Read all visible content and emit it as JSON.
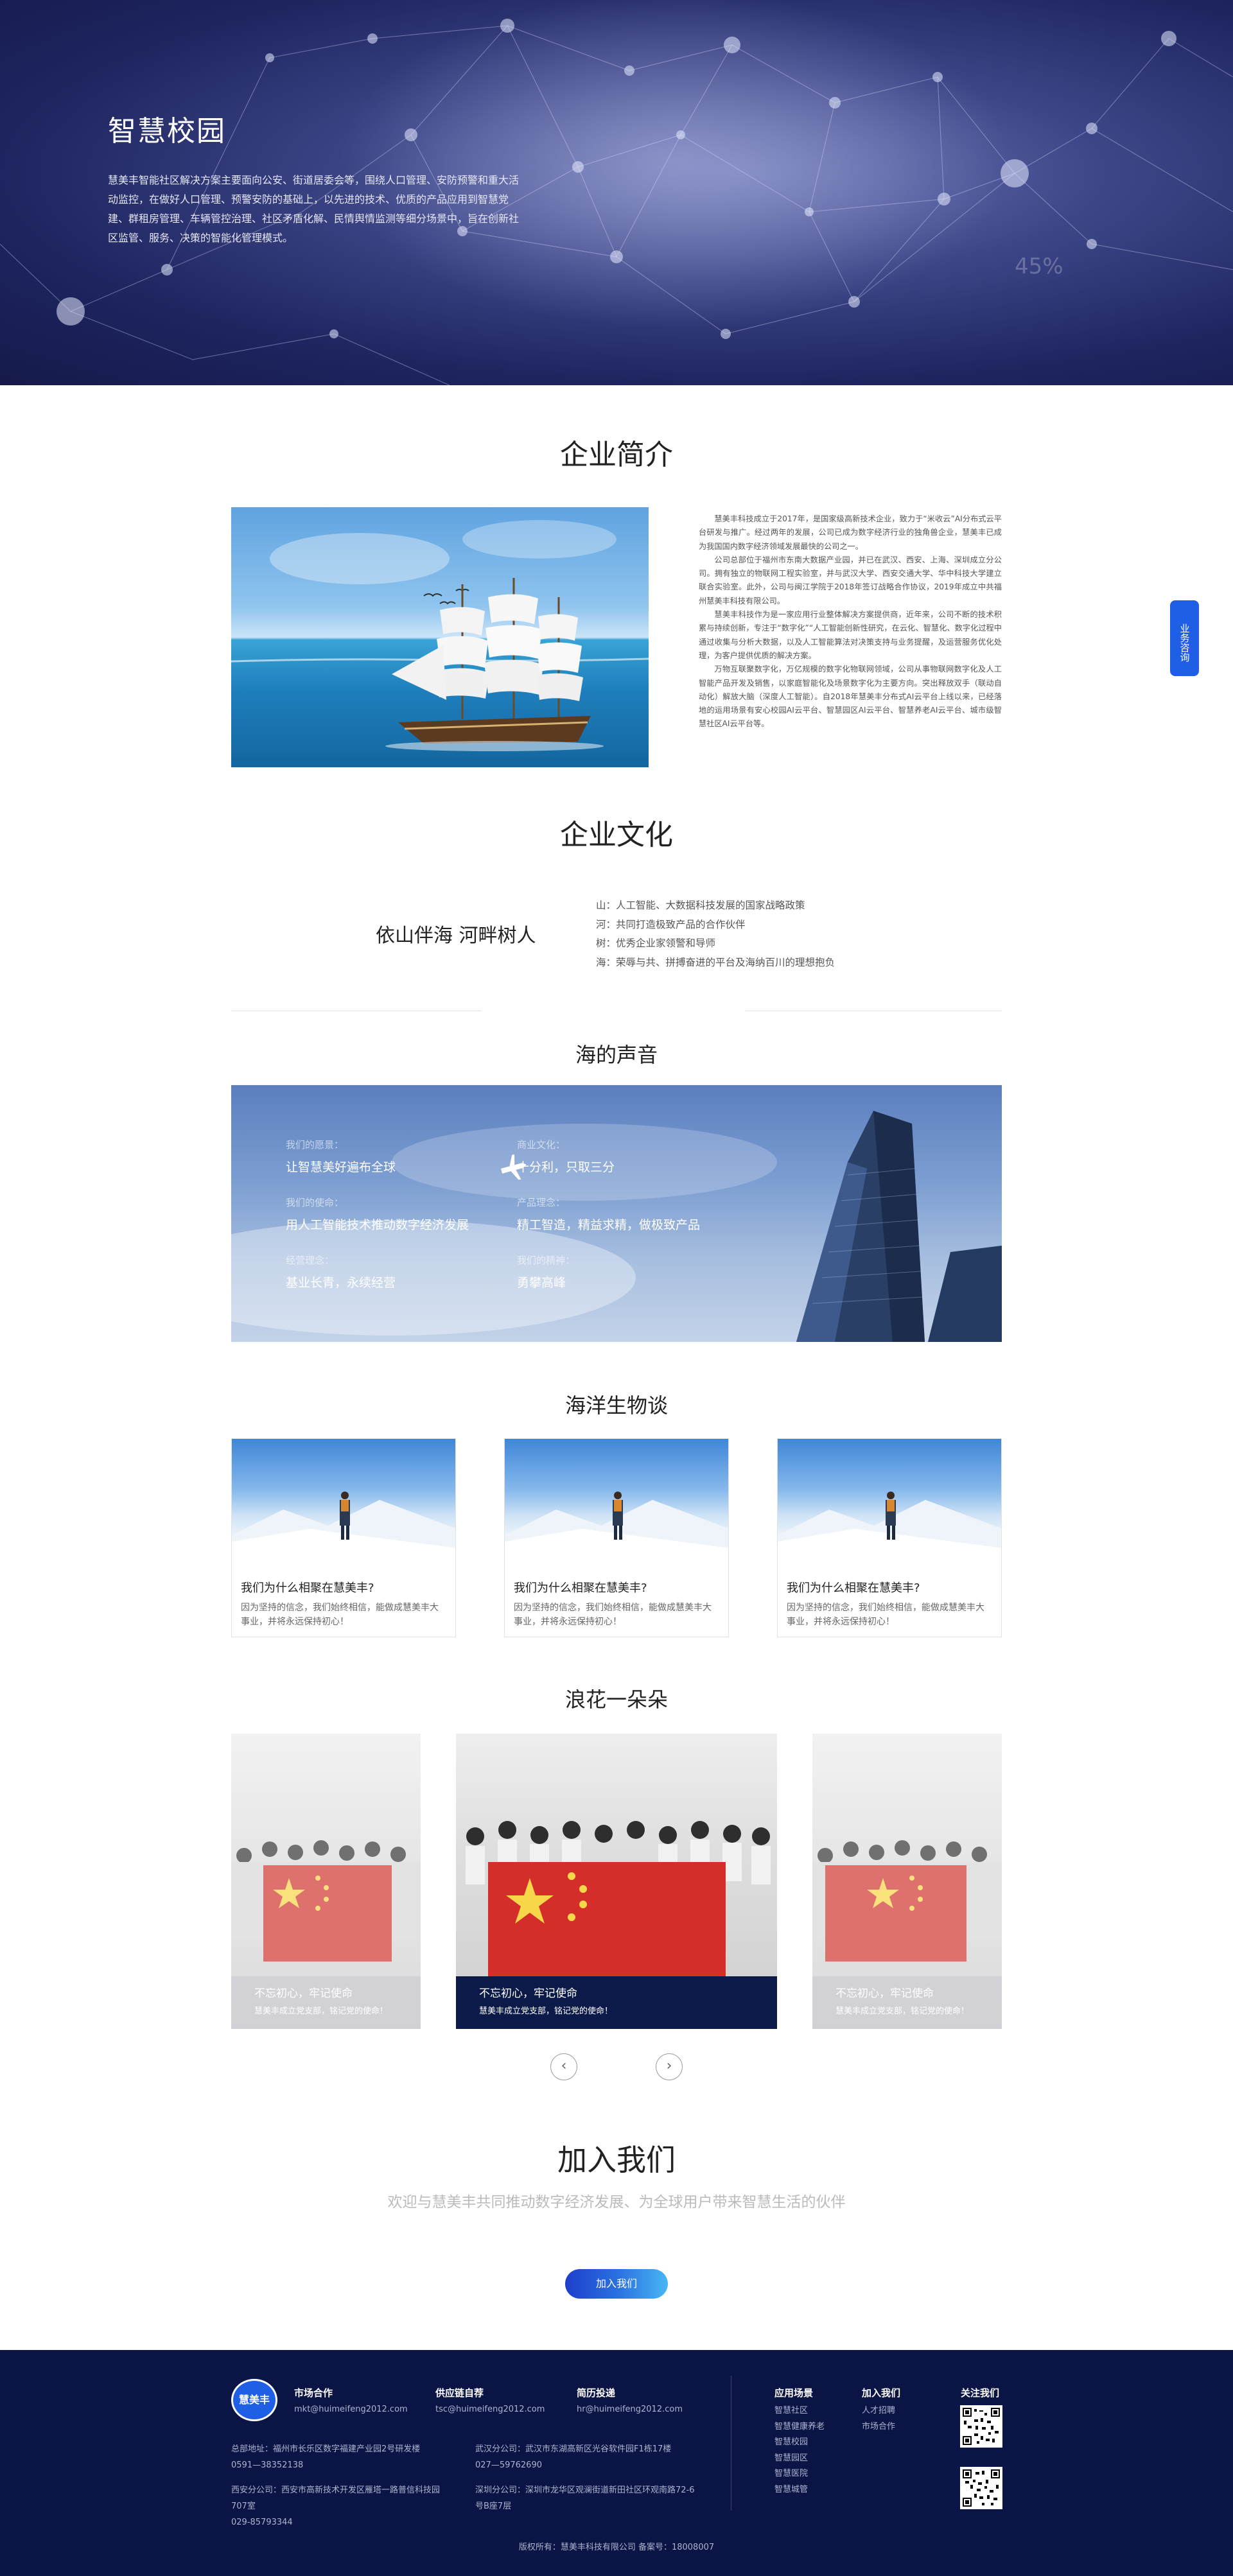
{
  "hero": {
    "title": "智慧校园",
    "desc": "慧美丰智能社区解决方案主要面向公安、街道居委会等，围绕人口管理、安防预警和重大活动监控，在做好人口管理、预警安防的基础上，以先进的技术、优质的产品应用到智慧党建、群租房管理、车辆管控治理、社区矛盾化解、民情舆情监测等细分场景中，旨在创新社区监管、服务、决策的智能化管理模式。",
    "deco_number": "45%"
  },
  "side_consult": "业务咨询",
  "intro": {
    "title": "企业简介",
    "paragraphs": [
      "慧美丰科技成立于2017年，是国家级高新技术企业，致力于“米收云”AI分布式云平台研发与推广。经过两年的发展，公司已成为数字经济行业的独角兽企业，慧美丰已成为我国国内数字经济领域发展最快的公司之一。",
      "公司总部位于福州市东南大数据产业园，并已在武汉、西安、上海、深圳成立分公司。拥有独立的物联网工程实验室，并与武汉大学、西安交通大学、华中科技大学建立联合实验室。此外，公司与闽江学院于2018年签订战略合作协议，2019年成立中共福州慧美丰科技有限公司。",
      "慧美丰科技作为是一家应用行业整体解决方案提供商，近年来，公司不断的技术积累与持续创新，专注于“数字化”“人工智能创新性研究，在云化、智慧化、数字化过程中通过收集与分析大数据，以及人工智能算法对决策支持与业务提醒，及运营服务优化处理，为客户提供优质的解决方案。",
      "万物互联聚数字化，万亿规模的数字化物联网领域，公司从事物联网数字化及人工智能产品开发及销售，以家庭智能化及场景数字化为主要方向。突出释放双手（联动自动化）解放大脑（深度人工智能）。自2018年慧美丰分布式AI云平台上线以来，已经落地的运用场景有安心校园AI云平台、智慧园区AI云平台、智慧养老AI云平台、城市级智慧社区AI云平台等。"
    ]
  },
  "culture": {
    "title": "企业文化",
    "motto": "依山伴海 河畔树人",
    "items": [
      "山：人工智能、大数据科技发展的国家战略政策",
      "河：共同打造极致产品的合作伙伴",
      "树：优秀企业家领警和导师",
      "海：荣辱与共、拼搏奋进的平台及海纳百川的理想抱负"
    ]
  },
  "voice": {
    "title": "海的声音",
    "items": [
      {
        "k": "我们的愿景：",
        "v": "让智慧美好遍布全球"
      },
      {
        "k": "商业文化：",
        "v": "十分利，只取三分"
      },
      {
        "k": "我们的使命：",
        "v": "用人工智能技术推动数字经济发展"
      },
      {
        "k": "产品理念：",
        "v": "精工智造，精益求精，做极致产品"
      },
      {
        "k": "经营理念：",
        "v": "基业长青，永续经营"
      },
      {
        "k": "我们的精神：",
        "v": "勇攀高峰"
      }
    ]
  },
  "ocean": {
    "title": "海洋生物谈",
    "cards": [
      {
        "title": "我们为什么相聚在慧美丰?",
        "desc": "因为坚持的信念，我们始终相信，能做成慧美丰大事业，并将永远保持初心！"
      },
      {
        "title": "我们为什么相聚在慧美丰?",
        "desc": "因为坚持的信念，我们始终相信，能做成慧美丰大事业，并将永远保持初心！"
      },
      {
        "title": "我们为什么相聚在慧美丰?",
        "desc": "因为坚持的信念，我们始终相信，能做成慧美丰大事业，并将永远保持初心！"
      }
    ]
  },
  "flowers": {
    "title": "浪花一朵朵",
    "slides": [
      {
        "a": "不忘初心，牢记使命",
        "b": "慧美丰成立党支部，铭记党的使命！"
      },
      {
        "a": "不忘初心，牢记使命",
        "b": "慧美丰成立党支部，铭记党的使命！"
      },
      {
        "a": "不忘初心，牢记使命",
        "b": "慧美丰成立党支部，铭记党的使命！"
      }
    ],
    "prev": "‹",
    "next": "›"
  },
  "join": {
    "title": "加入我们",
    "subtitle": "欢迎与慧美丰共同推动数字经济发展、为全球用户带来智慧生活的伙伴",
    "button": "加入我们"
  },
  "footer": {
    "logo": "慧美丰",
    "contacts": [
      {
        "h": "市场合作",
        "m": "mkt@huimeifeng2012.com"
      },
      {
        "h": "供应链自荐",
        "m": "tsc@huimeifeng2012.com"
      },
      {
        "h": "简历投递",
        "m": "hr@huimeifeng2012.com"
      }
    ],
    "addr_left": [
      "总部地址：福州市长乐区数字福建产业园2号研发楼",
      "0591—38352138",
      "",
      "西安分公司：西安市高新技术开发区雁塔一路普信科技园707室",
      "029-85793344"
    ],
    "addr_right": [
      "武汉分公司：武汉市东湖高新区光谷软件园F1栋17楼",
      "027—59762690",
      "",
      "深圳分公司：深圳市龙华区观澜街道新田社区环观南路72-6号B座7层"
    ],
    "scenes_title": "应用场景",
    "scenes": [
      "智慧社区",
      "智慧健康养老",
      "智慧校园",
      "智慧园区",
      "智慧医院",
      "智慧城管"
    ],
    "join_title": "加入我们",
    "join_items": [
      "人才招聘",
      "市场合作"
    ],
    "follow_title": "关注我们",
    "copyright": "版权所有：慧美丰科技有限公司  备案号：18008007"
  }
}
